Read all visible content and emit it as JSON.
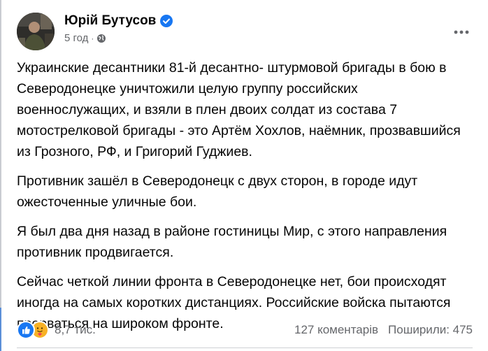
{
  "post": {
    "author": "Юрій Бутусов",
    "time": "5 год",
    "separator": "·",
    "paragraphs": [
      "Украинские десантники 81-й десантно- штурмовой бригады в бою в Северодонецке уничтожили целую группу российских военнослужащих, и взяли в плен двоих солдат из состава  7 мотострелковой бригады - это Артём Хохлов, наёмник, прозвавшийся из Грозного, РФ, и Григорий Гуджиев.",
      "Противник зашёл в Северодонецк с двух сторон, в городе идут ожесточенные уличные бои.",
      "Я был два дня назад в районе гостиницы Мир, с этого направления противник продвигается.",
      "Сейчас четкой линии фронта в Северодонецке нет, бои происходят иногда на самых коротких дистанциях. Российские войска пытаются прорваться на широком фронте."
    ]
  },
  "footer": {
    "reaction_count": "8,7 тис.",
    "comments": "127 коментарів",
    "shares": "Поширили: 475"
  },
  "icons": {
    "verified": "verified-badge-icon",
    "audience": "globe-icon",
    "more": "more-options-icon",
    "like": "like-reaction-icon",
    "care": "care-reaction-icon"
  },
  "colors": {
    "accent": "#1877f2",
    "secondary_text": "#65676b",
    "care": "#f7b125"
  }
}
